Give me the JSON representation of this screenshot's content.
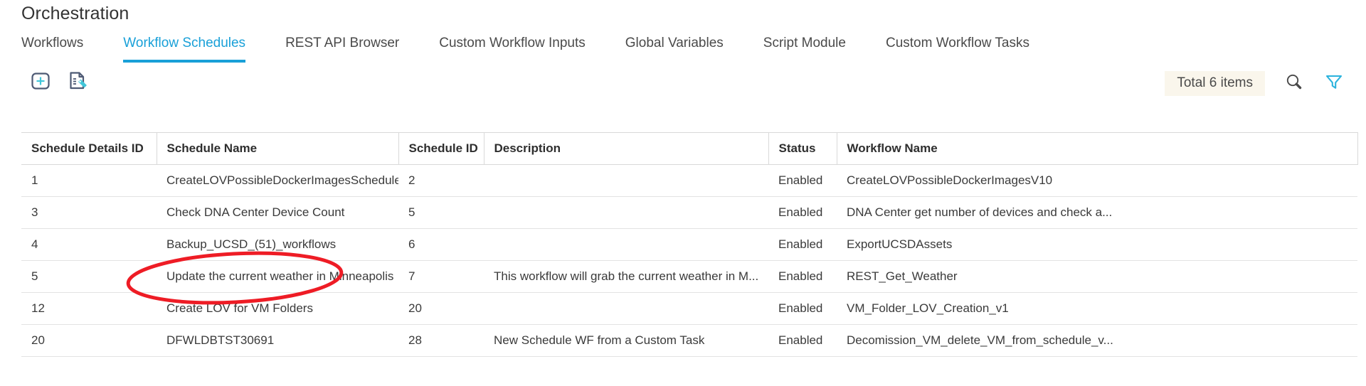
{
  "page": {
    "title": "Orchestration"
  },
  "tabs": [
    {
      "label": "Workflows",
      "active": false
    },
    {
      "label": "Workflow Schedules",
      "active": true
    },
    {
      "label": "REST API Browser",
      "active": false
    },
    {
      "label": "Custom Workflow Inputs",
      "active": false
    },
    {
      "label": "Global Variables",
      "active": false
    },
    {
      "label": "Script Module",
      "active": false
    },
    {
      "label": "Custom Workflow Tasks",
      "active": false
    }
  ],
  "toolbar": {
    "add_icon": "add-plus-box-icon",
    "report_icon": "document-tag-icon",
    "total_items": "Total 6 items",
    "search_icon": "search-icon",
    "filter_icon": "filter-funnel-icon"
  },
  "table": {
    "columns": [
      "Schedule Details ID",
      "Schedule Name",
      "Schedule ID",
      "Description",
      "Status",
      "Workflow Name"
    ],
    "rows": [
      {
        "schedule_details_id": "1",
        "schedule_name": "CreateLOVPossibleDockerImagesSchedule",
        "schedule_id": "2",
        "description": "",
        "status": "Enabled",
        "workflow_name": "CreateLOVPossibleDockerImagesV10"
      },
      {
        "schedule_details_id": "3",
        "schedule_name": "Check DNA Center Device Count",
        "schedule_id": "5",
        "description": "",
        "status": "Enabled",
        "workflow_name": "DNA Center get number of devices and check a..."
      },
      {
        "schedule_details_id": "4",
        "schedule_name": "Backup_UCSD_(51)_workflows",
        "schedule_id": "6",
        "description": "",
        "status": "Enabled",
        "workflow_name": "ExportUCSDAssets"
      },
      {
        "schedule_details_id": "5",
        "schedule_name": "Update the current weather in Minneapolis",
        "schedule_id": "7",
        "description": "This workflow will grab the current weather in M...",
        "status": "Enabled",
        "workflow_name": "REST_Get_Weather"
      },
      {
        "schedule_details_id": "12",
        "schedule_name": "Create LOV for VM Folders",
        "schedule_id": "20",
        "description": "",
        "status": "Enabled",
        "workflow_name": "VM_Folder_LOV_Creation_v1"
      },
      {
        "schedule_details_id": "20",
        "schedule_name": "DFWLDBTST30691",
        "schedule_id": "28",
        "description": "New Schedule WF from a Custom Task",
        "status": "Enabled",
        "workflow_name": "Decomission_VM_delete_VM_from_schedule_v..."
      }
    ]
  },
  "annotation": {
    "shape": "red-ellipse-highlight",
    "color": "#ee1c25"
  },
  "colors": {
    "accent": "#19a0d8",
    "icon_dark": "#4e5a74",
    "icon_teal": "#41c6d9",
    "badge_bg": "#faf6ec",
    "annotation": "#ee1c25"
  }
}
